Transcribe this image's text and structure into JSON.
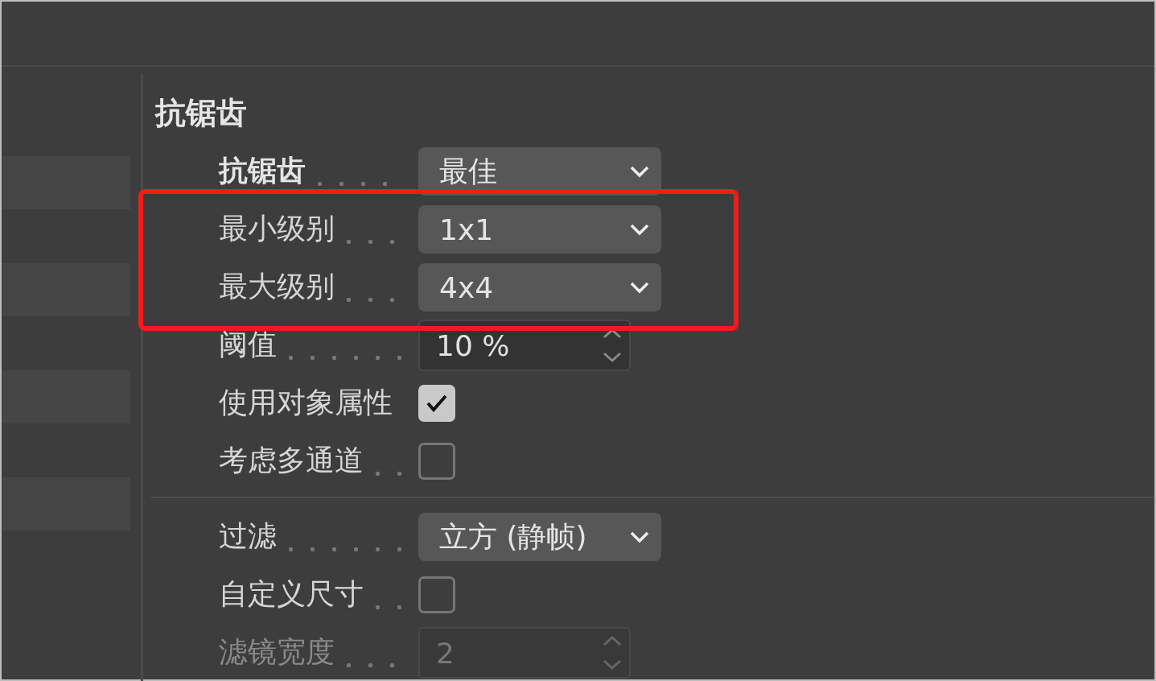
{
  "section": {
    "title": "抗锯齿"
  },
  "rows": [
    {
      "kind": "dropdown",
      "label": "抗锯齿",
      "value": "最佳",
      "bold": true,
      "disabled": false,
      "highlighted": false
    },
    {
      "kind": "dropdown",
      "label": "最小级别",
      "value": "1x1",
      "bold": false,
      "disabled": false,
      "highlighted": true
    },
    {
      "kind": "dropdown",
      "label": "最大级别",
      "value": "4x4",
      "bold": false,
      "disabled": false,
      "highlighted": true
    },
    {
      "kind": "number",
      "label": "阈值",
      "value": "10 %",
      "bold": false,
      "disabled": false,
      "highlighted": false
    },
    {
      "kind": "checkbox",
      "label": "使用对象属性",
      "checked": true,
      "bold": false,
      "disabled": false,
      "highlighted": false
    },
    {
      "kind": "checkbox",
      "label": "考虑多通道",
      "checked": false,
      "bold": false,
      "disabled": false,
      "highlighted": false
    },
    {
      "kind": "separator"
    },
    {
      "kind": "dropdown",
      "label": "过滤",
      "value": "立方 (静帧)",
      "bold": false,
      "disabled": false,
      "highlighted": false
    },
    {
      "kind": "checkbox",
      "label": "自定义尺寸",
      "checked": false,
      "bold": false,
      "disabled": false,
      "highlighted": false
    },
    {
      "kind": "number",
      "label": "滤镜宽度",
      "value": "2",
      "bold": false,
      "disabled": true,
      "highlighted": false
    }
  ]
}
